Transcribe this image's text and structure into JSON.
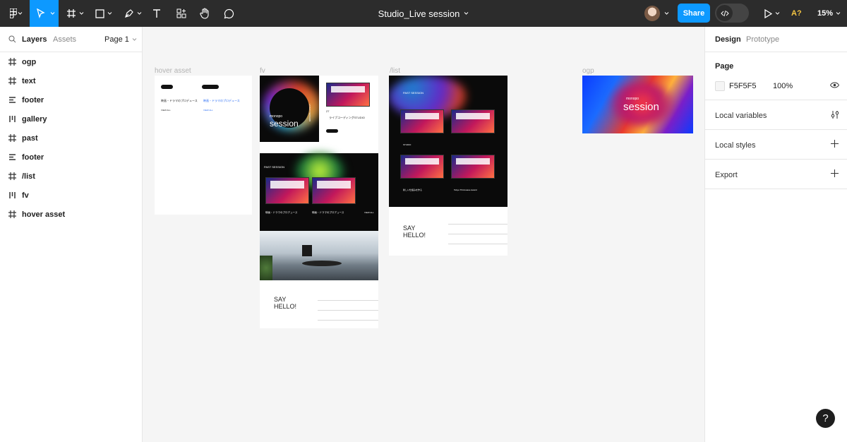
{
  "toolbar": {
    "doc_title": "Studio_Live session",
    "share_label": "Share",
    "aq_label": "A?",
    "zoom_label": "15%"
  },
  "left_panel": {
    "tab_layers": "Layers",
    "tab_assets": "Assets",
    "page_label": "Page 1",
    "layers": [
      {
        "name": "ogp",
        "icon": "frame-icon"
      },
      {
        "name": "text",
        "icon": "frame-icon"
      },
      {
        "name": "footer",
        "icon": "rows-layout-icon"
      },
      {
        "name": "gallery",
        "icon": "columns-layout-icon"
      },
      {
        "name": "past",
        "icon": "frame-icon"
      },
      {
        "name": "footer",
        "icon": "rows-layout-icon"
      },
      {
        "name": "/list",
        "icon": "frame-icon"
      },
      {
        "name": "fv",
        "icon": "columns-layout-icon"
      },
      {
        "name": "hover asset",
        "icon": "frame-icon"
      }
    ]
  },
  "right_panel": {
    "tab_design": "Design",
    "tab_prototype": "Prototype",
    "page_heading": "Page",
    "page_color": "F5F5F5",
    "page_opacity": "100%",
    "local_variables": "Local variables",
    "local_styles": "Local styles",
    "export": "Export"
  },
  "canvas": {
    "frame_hover": "hover asset",
    "frame_fv": "fv",
    "frame_list": "/list",
    "frame_ogp": "ogp",
    "hover": {
      "item1": "映画・ドラマのプロデュース",
      "item2": "映画・ドラマのプロデュース",
      "link": "VIEW ALL"
    },
    "fv": {
      "brand": "monopo",
      "session": "session",
      "vertical": "LATEST SESSION",
      "card_title": "ライブコーディングSTUDIO",
      "past_label": "PAST SESSION",
      "past_item1": "映画・ドラマのプロデュース",
      "past_item2": "映画・ドラマのプロデュース",
      "view_all": "VIEW ALL",
      "say": "SAY",
      "hello": "HELLO!",
      "number": "27"
    },
    "list": {
      "past_label": "PAST SESSION",
      "item1": "映画・ドラマのプロデュース",
      "item2": "映画・ドラマのプロデュース",
      "item3": "STUDIO",
      "item4": "新しい仕組みを作る",
      "item5": "Tokyo Third-wave Award",
      "say": "SAY",
      "hello": "HELLO!"
    },
    "ogp": {
      "brand": "monopo",
      "session": "session"
    }
  },
  "help_label": "?"
}
